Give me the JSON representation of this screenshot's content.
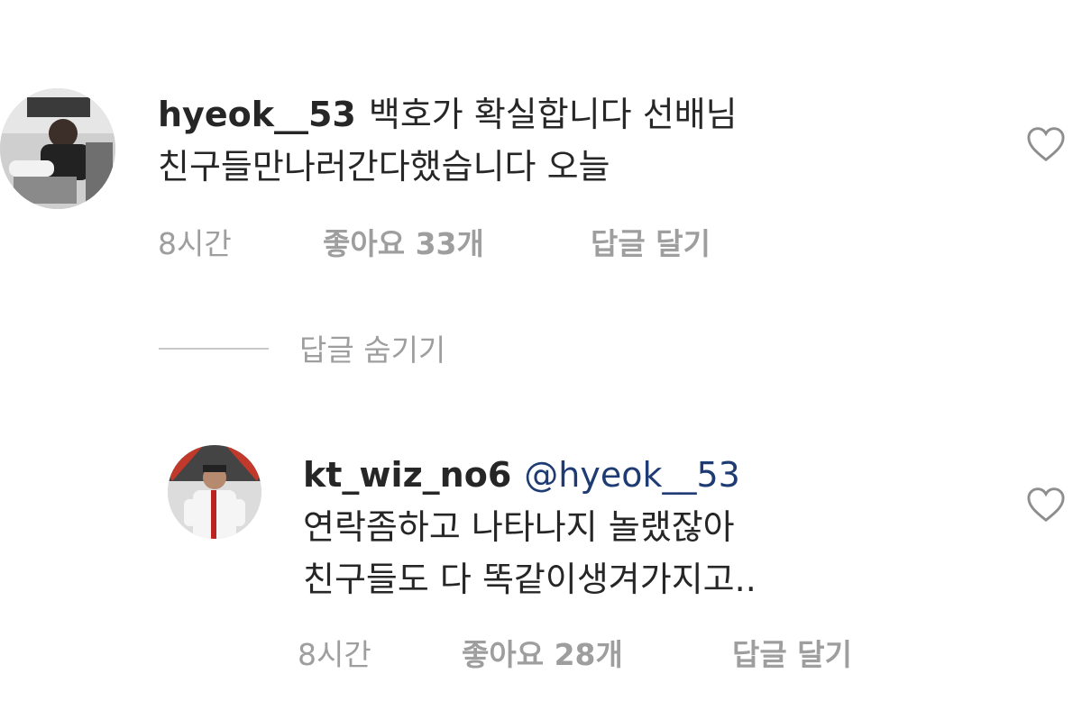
{
  "comments": [
    {
      "username": "hyeok__53",
      "mention": "",
      "line1": "백호가 확실합니다 선배님",
      "line2": "친구들만나러간다했습니다 오늘",
      "line3": "",
      "time": "8시간",
      "likes": "좋아요 33개",
      "reply": "답글 달기",
      "icons": {
        "like": "heart-outline-icon"
      }
    },
    {
      "username": "kt_wiz_no6",
      "mention": "@hyeok__53",
      "line1": "연락좀하고 나타나지 놀랬잖아",
      "line2": "친구들도 다 똑같이생겨가지고..",
      "time": "8시간",
      "likes": "좋아요 28개",
      "reply": "답글 달기",
      "icons": {
        "like": "heart-outline-icon"
      }
    }
  ],
  "replies_toggle": {
    "label": "답글 숨기기"
  },
  "colors": {
    "text": "#262626",
    "meta": "#9e9e9e",
    "mention": "#1f3b73",
    "divider": "#c8c8c8"
  }
}
